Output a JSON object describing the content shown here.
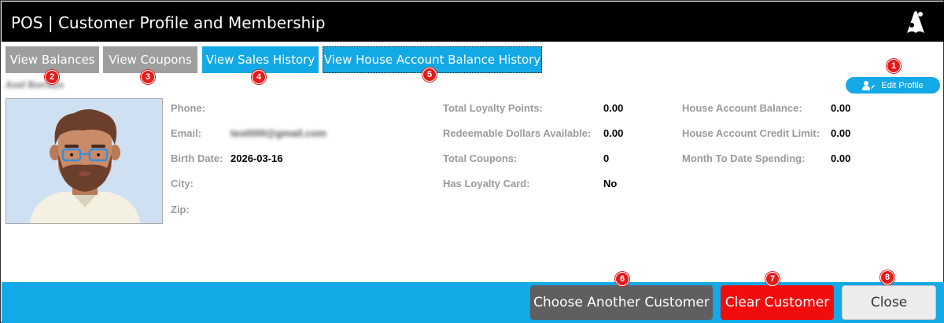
{
  "window": {
    "title": "POS | Customer Profile and Membership",
    "logo_icon": "app-logo-icon"
  },
  "tabs": [
    {
      "label": "View Balances",
      "marker": "2"
    },
    {
      "label": "View Coupons",
      "marker": "3"
    },
    {
      "label": "View Sales History",
      "marker": "4"
    },
    {
      "label": "View House Account Balance History",
      "marker": "5"
    }
  ],
  "customer": {
    "name": "Axel Borrazo"
  },
  "edit_profile": {
    "label": "Edit Profile",
    "marker": "1",
    "icon": "user-edit-icon"
  },
  "contact": {
    "phone_label": "Phone:",
    "phone_value": "",
    "email_label": "Email:",
    "email_value": "test000@gmail.com",
    "birth_label": "Birth Date:",
    "birth_value": "2026-03-16",
    "city_label": "City:",
    "city_value": "",
    "zip_label": "Zip:",
    "zip_value": ""
  },
  "loyalty": {
    "points_label": "Total Loyalty Points:",
    "points_value": "0.00",
    "redeemable_label": "Redeemable Dollars Available:",
    "redeemable_value": "0.00",
    "coupons_label": "Total Coupons:",
    "coupons_value": "0",
    "card_label": "Has Loyalty Card:",
    "card_value": "No"
  },
  "house_account": {
    "balance_label": "House Account Balance:",
    "balance_value": "0.00",
    "credit_label": "House Account Credit Limit:",
    "credit_value": "0.00",
    "mtd_label": "Month To Date Spending:",
    "mtd_value": "0.00"
  },
  "actions": {
    "choose": {
      "label": "Choose Another Customer",
      "marker": "6"
    },
    "clear": {
      "label": "Clear Customer",
      "marker": "7"
    },
    "close": {
      "label": "Close",
      "marker": "8"
    }
  },
  "colors": {
    "accent": "#12a9e6",
    "danger": "#f20d0d",
    "marker": "#e21b1b",
    "tab_gray": "#9e9e9e"
  }
}
